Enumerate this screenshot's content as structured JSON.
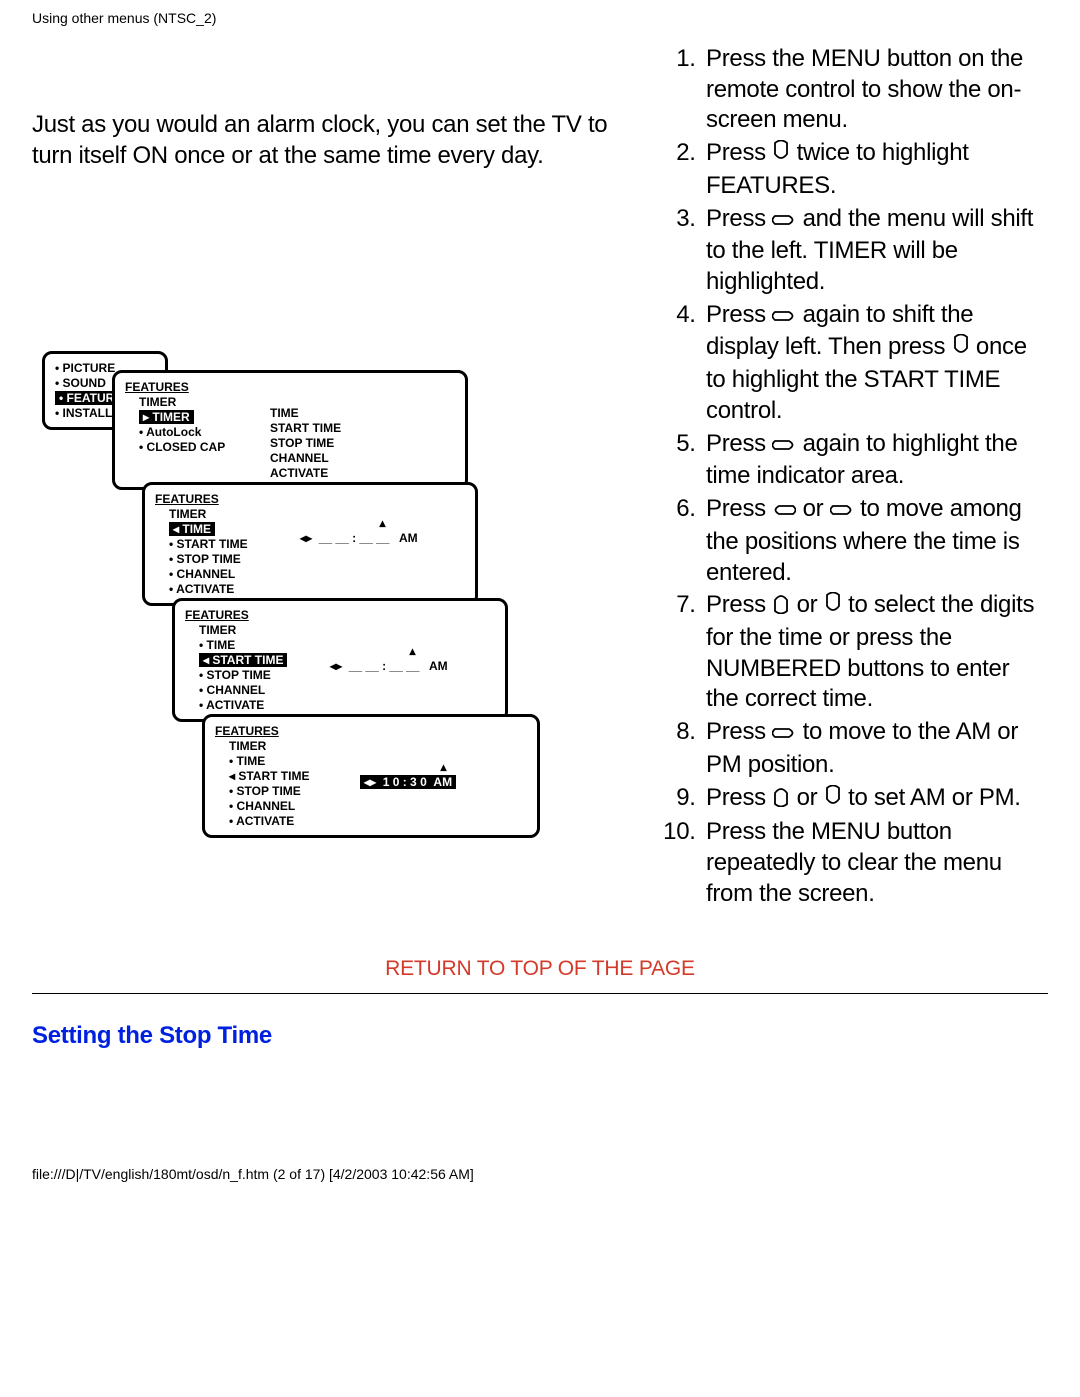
{
  "header": "Using other menus (NTSC_2)",
  "intro": "Just as you would an alarm clock, you can set the TV to turn itself ON once or at the same time every day.",
  "menu": {
    "screen1": {
      "items": [
        "PICTURE",
        "SOUND",
        "FEATURES",
        "INSTALL"
      ],
      "hl": "FEATURES"
    },
    "screen2": {
      "head": "FEATURES",
      "sub": "TIMER",
      "left": [
        "TIMER",
        "AutoLock",
        "CLOSED CAP"
      ],
      "hl": "TIMER",
      "right": [
        "TIME",
        "START TIME",
        "STOP TIME",
        "CHANNEL",
        "ACTIVATE"
      ]
    },
    "screen3": {
      "head": "FEATURES",
      "sub": "TIMER",
      "items": [
        "TIME",
        "START TIME",
        "STOP TIME",
        "CHANNEL",
        "ACTIVATE"
      ],
      "hl": "TIME",
      "time": "__ __ : __ __  AM"
    },
    "screen4": {
      "head": "FEATURES",
      "sub": "TIMER",
      "items": [
        "TIME",
        "START TIME",
        "STOP TIME",
        "CHANNEL",
        "ACTIVATE"
      ],
      "hl": "START TIME",
      "time": "__ __ : __ __  AM"
    },
    "screen5": {
      "head": "FEATURES",
      "sub": "TIMER",
      "items": [
        "TIME",
        "START TIME",
        "STOP TIME",
        "CHANNEL",
        "ACTIVATE"
      ],
      "hl": "START TIME",
      "time": "10 : 30  AM"
    }
  },
  "steps": {
    "s1": "Press the MENU button on the remote control to show the on-screen menu.",
    "s2a": "Press ",
    "s2b": " twice to highlight FEATURES.",
    "s3a": "Press ",
    "s3b": " and the menu will shift to the left. TIMER will be highlighted.",
    "s4a": "Press ",
    "s4b": " again to shift the display left. Then press ",
    "s4c": " once to highlight the START TIME control.",
    "s5a": "Press ",
    "s5b": " again to highlight the time indicator area.",
    "s6a": "Press ",
    "s6b": " or ",
    "s6c": " to move among the positions where the time is entered.",
    "s7a": "Press ",
    "s7b": " or ",
    "s7c": " to select the digits for the time or press the NUMBERED buttons to enter the correct time.",
    "s8a": "Press ",
    "s8b": " to move to the AM or PM position.",
    "s9a": "Press ",
    "s9b": " or ",
    "s9c": " to set AM or PM.",
    "s10": "Press the MENU button repeatedly to clear the menu from the screen."
  },
  "returnLink": "RETURN TO TOP OF THE PAGE",
  "sectionHeading": "Setting the Stop Time",
  "footer": "file:///D|/TV/english/180mt/osd/n_f.htm (2 of 17) [4/2/2003 10:42:56 AM]"
}
